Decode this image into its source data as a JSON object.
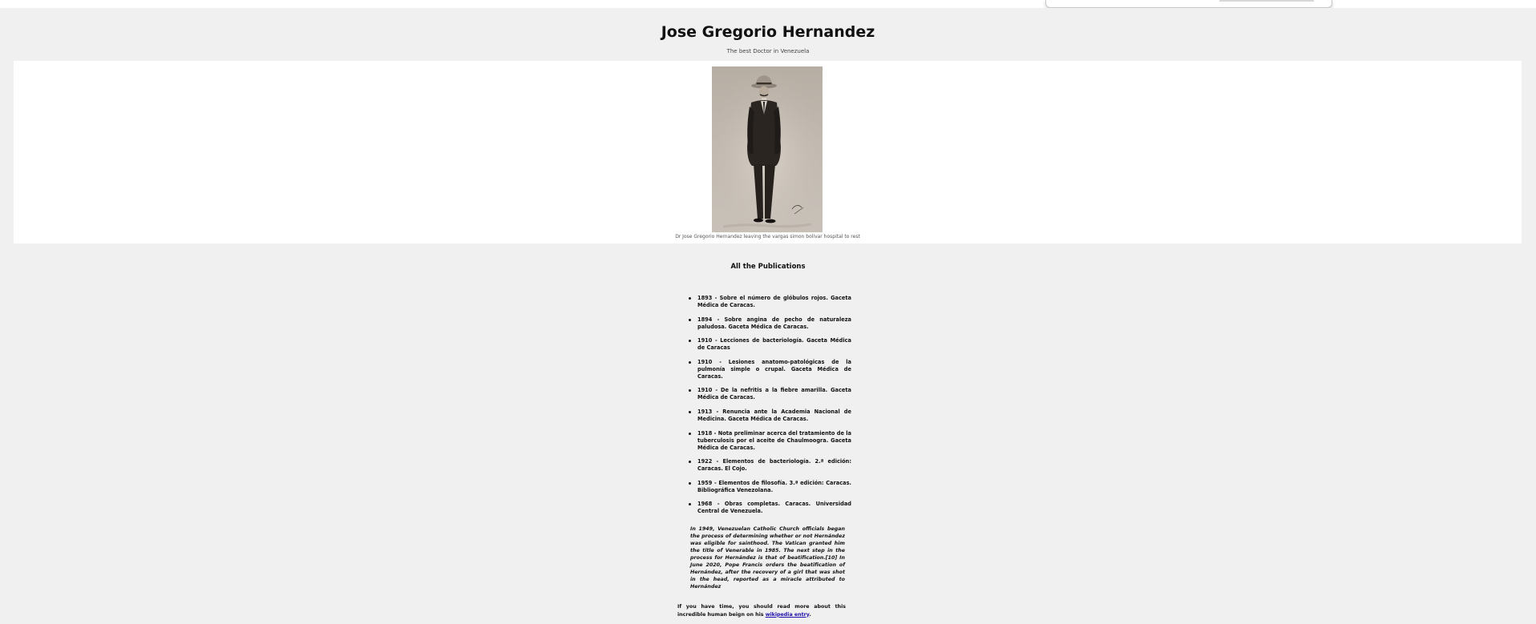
{
  "page": {
    "title": "Jose Gregorio Hernandez",
    "tagline": "The best Doctor in Venezuela"
  },
  "figure": {
    "caption": "Dr Jose Gregorio Hernandez leaving the vargas simon bolivar hospital to rest",
    "image": "sepia-portrait-of-man-in-hat-and-dark-suit"
  },
  "publications": {
    "heading": "All the Publications",
    "items": [
      "1893 - Sobre el número de glóbulos rojos. Gaceta Médica de Caracas.",
      "1894 - Sobre angina de pecho de naturaleza paludosa. Gaceta Médica de Caracas.",
      "1910 - Lecciones de bacteriología. Gaceta Médica de Caracas",
      "1910 - Lesiones anatomo-patológicas de la pulmonía simple o crupal. Gaceta Médica de Caracas.",
      "1910 - De la nefritis a la fiebre amarilla. Gaceta Médica de Caracas.",
      "1913 - Renuncia ante la Academia Nacional de Medicina. Gaceta Médica de Caracas.",
      "1918 - Nota preliminar acerca del tratamiento de la tuberculosis por el aceite de Chaulmoogra. Gaceta Médica de Caracas.",
      "1922 - Elementos de bacteriología. 2.ª edición: Caracas. El Cojo.",
      "1959 - Elementos de filosofía. 3.ª edición: Caracas. Bibliográfica Venezolana.",
      "1968 - Obras completas. Caracas. Universidad Central de Venezuela."
    ]
  },
  "history": "In 1949, Venezuelan Catholic Church officials began the process of determining whether or not Hernández was eligible for sainthood. The Vatican granted him the title of Venerable in 1985. The next step in the process for Hernández is that of beatification.[10] In June 2020, Pope Francis orders the beatification of Hernández, after the recovery of a girl that was shot in the head, reported as a miracle attributed to Hernández",
  "more": {
    "text": "If you have time, you should read more about this incredible human beign on his ",
    "link_label": "wikipedia entry",
    "suffix": "."
  },
  "colors": {
    "page_background": "#f0f0f0",
    "figure_background": "#ffffff",
    "link": "#1a0dab"
  }
}
